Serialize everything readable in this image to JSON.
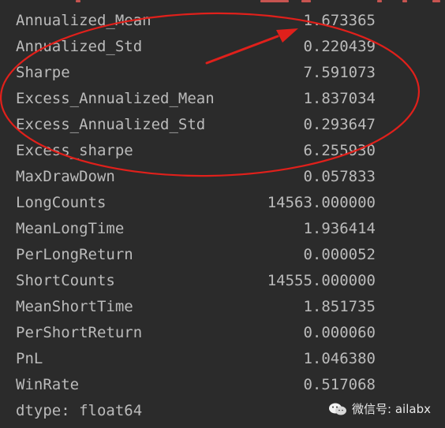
{
  "colors": {
    "background": "#2b2b2b",
    "text": "#bbbbbb",
    "annotation": "#e0201b"
  },
  "series": [
    {
      "label": "Annualized_Mean",
      "value": "1.673365"
    },
    {
      "label": "Annualized_Std",
      "value": "0.220439"
    },
    {
      "label": "Sharpe",
      "value": "7.591073"
    },
    {
      "label": "Excess_Annualized_Mean",
      "value": "1.837034"
    },
    {
      "label": "Excess_Annualized_Std",
      "value": "0.293647"
    },
    {
      "label": "Excess_sharpe",
      "value": "6.255930"
    },
    {
      "label": "MaxDrawDown",
      "value": "0.057833"
    },
    {
      "label": "LongCounts",
      "value": "14563.000000"
    },
    {
      "label": "MeanLongTime",
      "value": "1.936414"
    },
    {
      "label": "PerLongReturn",
      "value": "0.000052"
    },
    {
      "label": "ShortCounts",
      "value": "14555.000000"
    },
    {
      "label": "MeanShortTime",
      "value": "1.851735"
    },
    {
      "label": "PerShortReturn",
      "value": "0.000060"
    },
    {
      "label": "PnL",
      "value": "1.046380"
    },
    {
      "label": "WinRate",
      "value": "0.517068"
    }
  ],
  "dtype": "dtype: float64",
  "watermark": {
    "icon": "wechat-icon",
    "text": "微信号: ailabx"
  }
}
